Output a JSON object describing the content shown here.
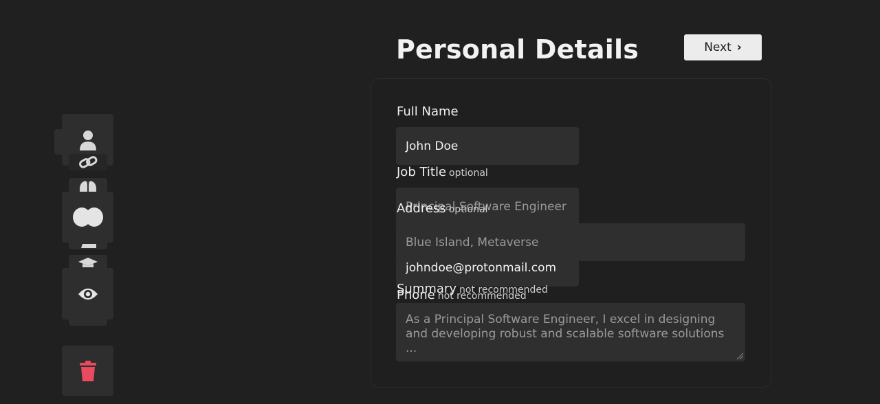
{
  "header": {
    "title": "Personal Details",
    "next_label": "Next"
  },
  "sidebar": {
    "items": [
      {
        "name": "personal",
        "icon": "person-icon"
      },
      {
        "name": "links",
        "icon": "link-icon"
      },
      {
        "name": "skills",
        "icon": "brain-icon"
      },
      {
        "name": "interests",
        "icon": "blob-icon"
      },
      {
        "name": "education",
        "icon": "graduation-cap-icon"
      },
      {
        "name": "preview",
        "icon": "eye-icon"
      },
      {
        "name": "delete",
        "icon": "trash-icon"
      }
    ]
  },
  "form": {
    "full_name": {
      "label": "Full Name",
      "value": "John Doe"
    },
    "job_title": {
      "label": "Job Title",
      "tag": "optional",
      "placeholder": "Principal Software Engineer"
    },
    "address": {
      "label": "Address",
      "tag": "optional",
      "placeholder": "Blue Island, Metaverse"
    },
    "email": {
      "value": "johndoe@protonmail.com"
    },
    "phone": {
      "label": "Phone",
      "tag": "not recommended"
    },
    "summary": {
      "label": "Summary",
      "tag": "not recommended",
      "placeholder": "As a Principal Software Engineer, I excel in designing and developing robust and scalable software solutions ..."
    }
  },
  "colors": {
    "background": "#202020",
    "input_bg": "#2f2f2f",
    "danger": "#e84a5f",
    "button_bg": "#ececec"
  }
}
